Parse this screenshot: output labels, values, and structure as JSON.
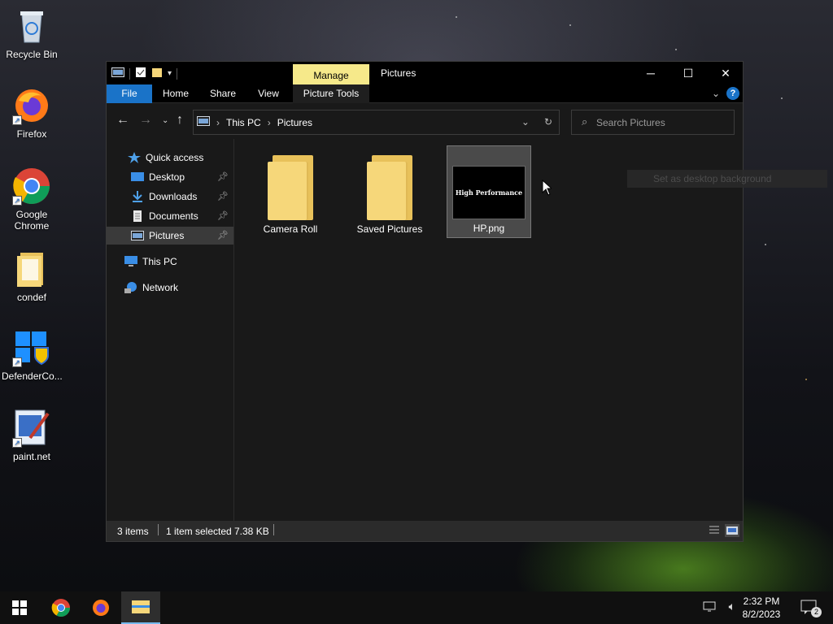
{
  "desktop": {
    "icons": [
      {
        "label": "Recycle Bin"
      },
      {
        "label": "Firefox"
      },
      {
        "label": "Google Chrome"
      },
      {
        "label": "condef"
      },
      {
        "label": "DefenderCo..."
      },
      {
        "label": "paint.net"
      }
    ]
  },
  "window": {
    "title": "Pictures",
    "manage_tab": "Manage",
    "ribbon_tabs": [
      "File",
      "Home",
      "Share",
      "View",
      "Picture Tools"
    ],
    "help": "?",
    "address": {
      "crumbs": [
        "This PC",
        "Pictures"
      ]
    },
    "search": {
      "placeholder": "Search Pictures"
    },
    "sidebar": {
      "quick_access": "Quick access",
      "items": [
        {
          "label": "Desktop",
          "pinned": true
        },
        {
          "label": "Downloads",
          "pinned": true
        },
        {
          "label": "Documents",
          "pinned": true
        },
        {
          "label": "Pictures",
          "pinned": true,
          "selected": true
        }
      ],
      "this_pc": "This PC",
      "network": "Network"
    },
    "files": [
      {
        "name": "Camera Roll",
        "type": "folder"
      },
      {
        "name": "Saved Pictures",
        "type": "folder"
      },
      {
        "name": "HP.png",
        "type": "image",
        "thumb_text": "High Performance",
        "selected": true
      }
    ],
    "tooltip": "Set as desktop background",
    "status": {
      "items": "3 items",
      "selected": "1 item selected",
      "size": "7.38 KB"
    }
  },
  "taskbar": {
    "time": "2:32 PM",
    "date": "8/2/2023",
    "notifications": "2"
  }
}
